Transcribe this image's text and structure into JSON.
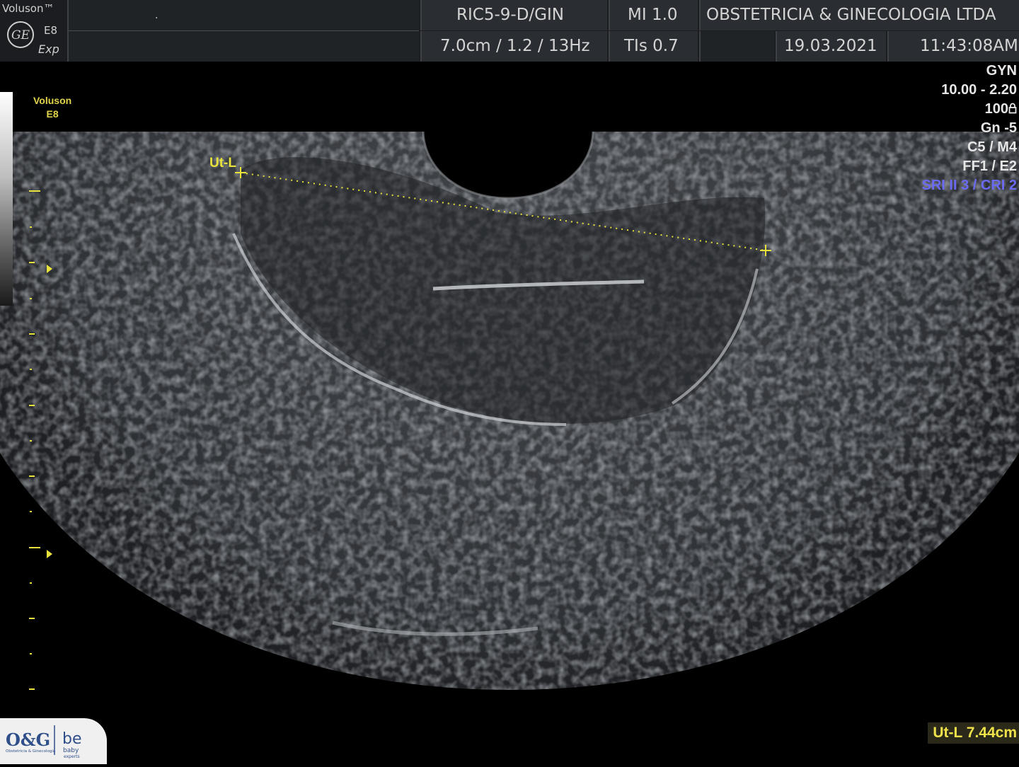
{
  "header": {
    "brand_name": "Voluson™",
    "model": "E8",
    "mode": "Exp",
    "probe": "RIC5-9-D/GIN",
    "depth_settings": "7.0cm / 1.2 / 13Hz",
    "mi": "MI  1.0",
    "tis": "TIs  0.7",
    "institution": "OBSTETRICIA & GINECOLOGIA LTDA",
    "date": "19.03.2021",
    "time": "11:43:08AM",
    "patient_field": "."
  },
  "right_panel": {
    "preset": "GYN",
    "frequency": "10.00 - 2.20",
    "power": "100",
    "gain": "Gn  -5",
    "cm": "C5 / M4",
    "ff": "FF1 / E2",
    "sri": "SRI II 3 / CRI 2"
  },
  "left_mark": {
    "line1": "Voluson",
    "line2": "E8"
  },
  "measurement": {
    "caliper_label": "Ut-L",
    "result": "Ut-L 7.44cm"
  },
  "watermark": {
    "text1": "O&G",
    "text2": "Obstetricia & Ginecologia",
    "text3": "be baby experts"
  },
  "colors": {
    "annotation_yellow": "#e8e23c",
    "info_blue": "#6a6af2"
  }
}
